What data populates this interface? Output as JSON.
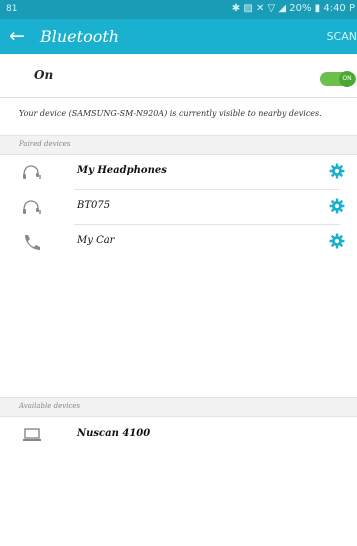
{
  "statusbar": {
    "left": "81",
    "right": "✱ ▨ ✕ ▽ ◢ 20% ▮ 4:40 P"
  },
  "appbar": {
    "back_glyph": "←",
    "title": "Bluetooth",
    "scan_label": "SCAN"
  },
  "master": {
    "label": "On",
    "toggle_text": "ON",
    "toggle_state": "on",
    "toggle_color": "#6ac04b"
  },
  "visibility_text": "Your device (SAMSUNG-SM-N920A) is currently visible to nearby devices.",
  "paired": {
    "header": "Paired devices",
    "devices": [
      {
        "name": "My Headphones",
        "icon": "headphones-icon",
        "has_settings": true
      },
      {
        "name": "BT075",
        "icon": "headphones-icon",
        "has_settings": true
      },
      {
        "name": "My Car",
        "icon": "phone-icon",
        "has_settings": true
      }
    ]
  },
  "available": {
    "header": "Available devices",
    "devices": [
      {
        "name": "Nuscan 4100",
        "icon": "laptop-icon"
      }
    ]
  },
  "colors": {
    "statusbar": "#1a9bb6",
    "appbar": "#1ab0cf",
    "accent": "#1ab0cf"
  }
}
